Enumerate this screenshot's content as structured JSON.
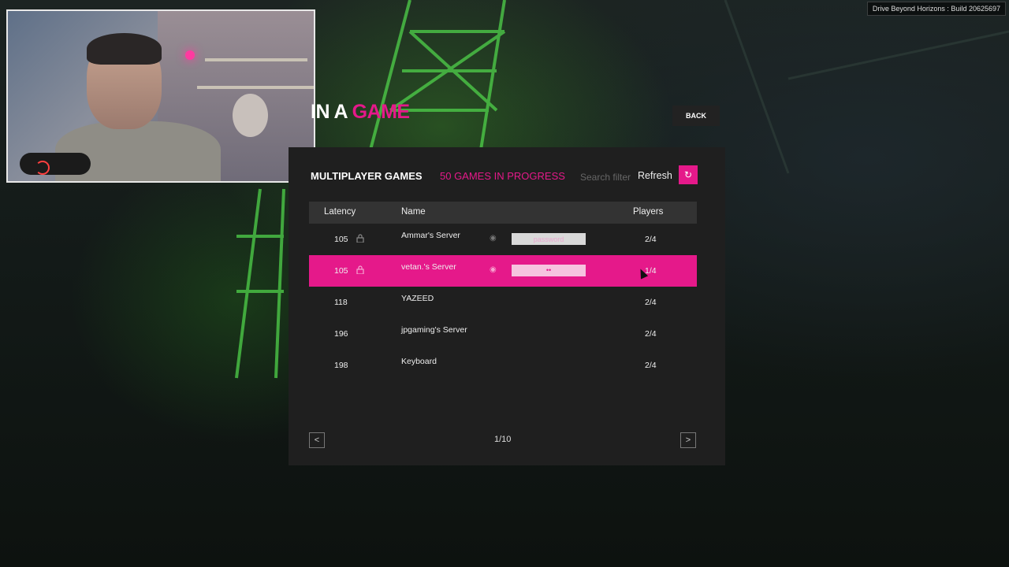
{
  "build": {
    "label": "Drive Beyond Horizons : Build 20625697"
  },
  "title": {
    "part1": "IN A ",
    "part2": "GAME"
  },
  "back_button": {
    "label": "BACK"
  },
  "panel": {
    "mp_label": "MULTIPLAYER GAMES",
    "games_count": "50 GAMES IN PROGRESS",
    "search_placeholder": "Search filter",
    "refresh_label": "Refresh"
  },
  "table": {
    "headers": {
      "latency": "Latency",
      "name": "Name",
      "players": "Players"
    },
    "rows": [
      {
        "latency": "105",
        "name": "Ammar's Server",
        "locked": true,
        "password_placeholder": "password",
        "password_value": "",
        "players": "2/4",
        "selected": false
      },
      {
        "latency": "105",
        "name": "vetan.'s Server",
        "locked": true,
        "password_placeholder": "",
        "password_value": "••",
        "players": "1/4",
        "selected": true
      },
      {
        "latency": "118",
        "name": "YAZEED",
        "locked": false,
        "players": "2/4",
        "selected": false
      },
      {
        "latency": "196",
        "name": "jpgaming's Server",
        "locked": false,
        "players": "2/4",
        "selected": false
      },
      {
        "latency": "198",
        "name": "Keyboard",
        "locked": false,
        "players": "2/4",
        "selected": false
      }
    ]
  },
  "pagination": {
    "label": "1/10",
    "prev_icon": "chevron-left",
    "next_icon": "chevron-right"
  },
  "colors": {
    "accent": "#e5198a",
    "panel": "#1f1f1f",
    "header": "#333333"
  }
}
